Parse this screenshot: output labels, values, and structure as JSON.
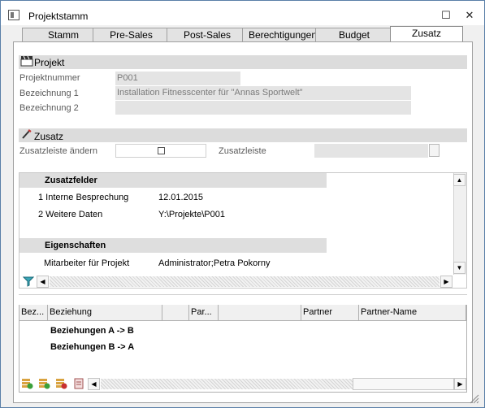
{
  "window": {
    "title": "Projektstamm",
    "minimize": "☐",
    "close": "✕"
  },
  "tabs": [
    {
      "label": "Stamm"
    },
    {
      "label": "Pre-Sales"
    },
    {
      "label": "Post-Sales"
    },
    {
      "label": "Berechtigungen"
    },
    {
      "label": "Budget"
    },
    {
      "label": "Zusatz"
    }
  ],
  "projekt": {
    "header": "Projekt",
    "projektnummer_label": "Projektnummer",
    "projektnummer_value": "P001",
    "bez1_label": "Bezeichnung 1",
    "bez1_value": "Installation Fitnesscenter für \"Annas Sportwelt\"",
    "bez2_label": "Bezeichnung 2",
    "bez2_value": ""
  },
  "zusatz": {
    "header": "Zusatz",
    "aendern_label": "Zusatzleiste ändern",
    "leiste_label": "Zusatzleiste",
    "leiste_value": ""
  },
  "zusatzfelder": {
    "header": "Zusatzfelder",
    "rows": [
      {
        "label": "1 Interne Besprechung",
        "value": "12.01.2015"
      },
      {
        "label": "2 Weitere Daten",
        "value": "Y:\\Projekte\\P001"
      }
    ],
    "eig_header": "Eigenschaften",
    "eig_rows": [
      {
        "label": "Mitarbeiter für Projekt",
        "value": "Administrator;Petra Pokorny"
      }
    ]
  },
  "beziehungen": {
    "columns": [
      "Bez...",
      "Beziehung",
      "Par...",
      "Partner",
      "Partner-Name"
    ],
    "groups": [
      "Beziehungen A -> B",
      "Beziehungen B -> A"
    ]
  },
  "icons": {
    "projekt": "clapperboard-icon",
    "zusatz": "pencil-icon",
    "filter": "funnel-icon"
  }
}
